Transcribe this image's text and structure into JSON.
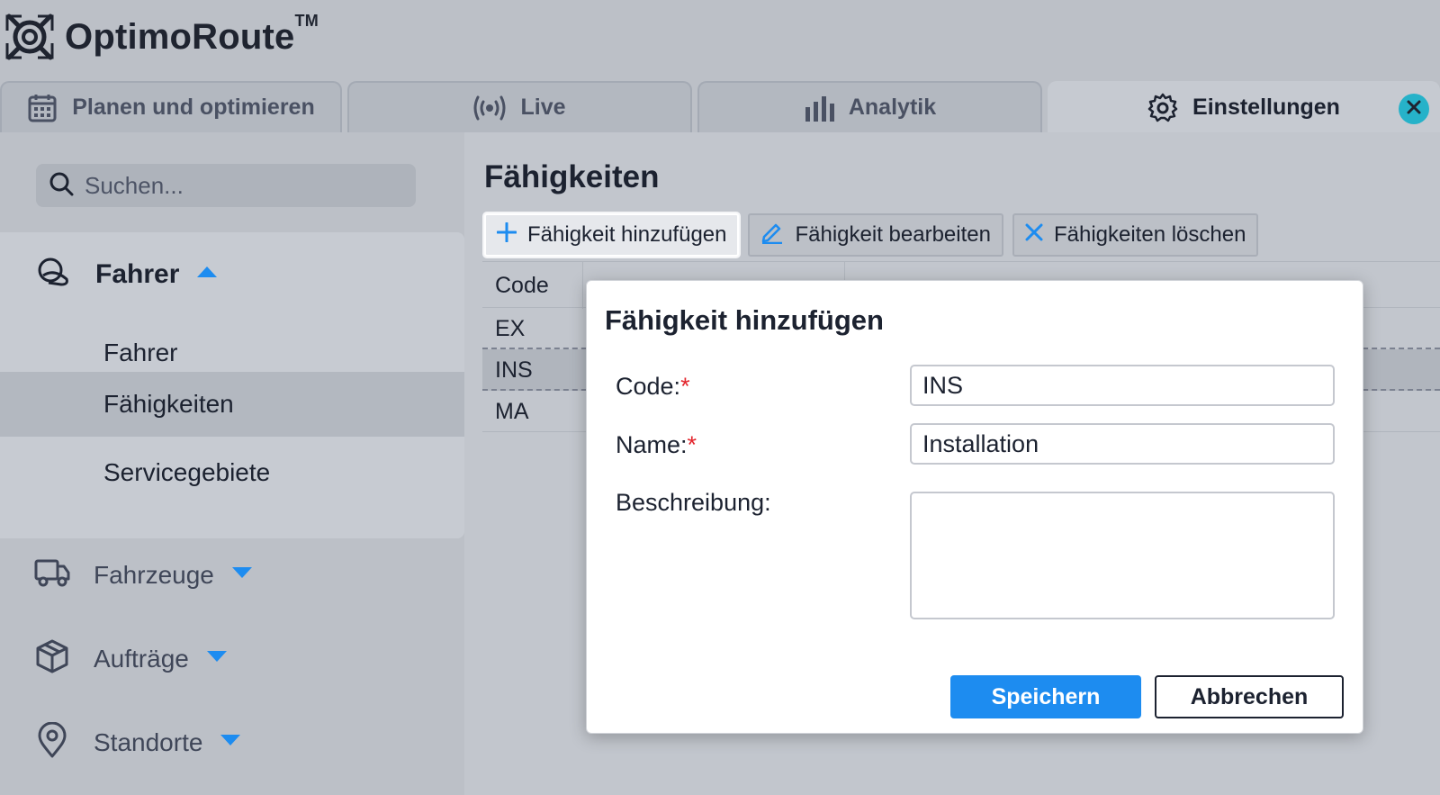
{
  "app": {
    "brand": "OptimoRoute",
    "trademark": "TM"
  },
  "tabs": [
    {
      "label": "Planen und optimieren",
      "icon": "calendar-icon",
      "active": false
    },
    {
      "label": "Live",
      "icon": "broadcast-icon",
      "active": false
    },
    {
      "label": "Analytik",
      "icon": "bar-chart-icon",
      "active": false
    },
    {
      "label": "Einstellungen",
      "icon": "gear-icon",
      "active": true
    }
  ],
  "sidebar": {
    "search_placeholder": "Suchen...",
    "group": {
      "label": "Fahrer",
      "icon": "driver-icon",
      "expanded": true
    },
    "sub_items": [
      {
        "label": "Fahrer",
        "selected": false
      },
      {
        "label": "Fähigkeiten",
        "selected": true
      },
      {
        "label": "Servicegebiete",
        "selected": false
      }
    ],
    "nav_items": [
      {
        "label": "Fahrzeuge",
        "icon": "truck-icon"
      },
      {
        "label": "Aufträge",
        "icon": "package-icon"
      },
      {
        "label": "Standorte",
        "icon": "location-pin-icon"
      }
    ]
  },
  "main": {
    "title": "Fähigkeiten",
    "toolbar": {
      "add_label": "Fähigkeit hinzufügen",
      "edit_label": "Fähigkeit bearbeiten",
      "delete_label": "Fähigkeiten löschen"
    },
    "table": {
      "headers": [
        "Code"
      ],
      "rows": [
        {
          "code": "EX",
          "selected": false
        },
        {
          "code": "INS",
          "selected": true
        },
        {
          "code": "MA",
          "selected": false
        }
      ]
    }
  },
  "dialog": {
    "title": "Fähigkeit hinzufügen",
    "code_label": "Code:",
    "name_label": "Name:",
    "description_label": "Beschreibung:",
    "required_marker": "*",
    "code_value": "INS",
    "name_value": "Installation",
    "description_value": "",
    "save_label": "Speichern",
    "cancel_label": "Abbrechen"
  },
  "colors": {
    "accent": "#1d8cf0",
    "close": "#26b2c9",
    "required": "#e3262d"
  }
}
